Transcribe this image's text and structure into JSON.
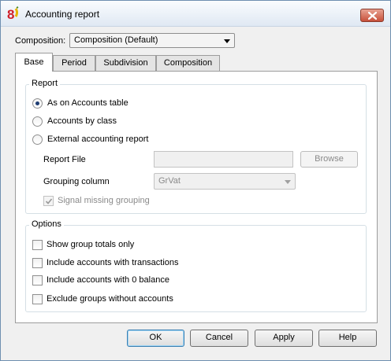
{
  "window": {
    "title": "Accounting report",
    "icon": "banana-app-icon",
    "close_icon": "close-icon"
  },
  "composition": {
    "label": "Composition:",
    "value": "Composition (Default)"
  },
  "tabs": [
    {
      "label": "Base",
      "active": true
    },
    {
      "label": "Period",
      "active": false
    },
    {
      "label": "Subdivision",
      "active": false
    },
    {
      "label": "Composition",
      "active": false
    }
  ],
  "report": {
    "title": "Report",
    "options": [
      {
        "label": "As on Accounts table",
        "selected": true
      },
      {
        "label": "Accounts by class",
        "selected": false
      },
      {
        "label": "External accounting report",
        "selected": false
      }
    ],
    "report_file_label": "Report File",
    "report_file_value": "",
    "browse_label": "Browse",
    "grouping_label": "Grouping column",
    "grouping_value": "GrVat",
    "signal_missing_label": "Signal missing grouping",
    "signal_missing_checked": true
  },
  "options": {
    "title": "Options",
    "items": [
      {
        "label": "Show group totals only",
        "checked": false
      },
      {
        "label": "Include accounts with transactions",
        "checked": false
      },
      {
        "label": "Include accounts with 0 balance",
        "checked": false
      },
      {
        "label": "Exclude groups without accounts",
        "checked": false
      }
    ]
  },
  "buttons": {
    "ok": "OK",
    "cancel": "Cancel",
    "apply": "Apply",
    "help": "Help"
  }
}
